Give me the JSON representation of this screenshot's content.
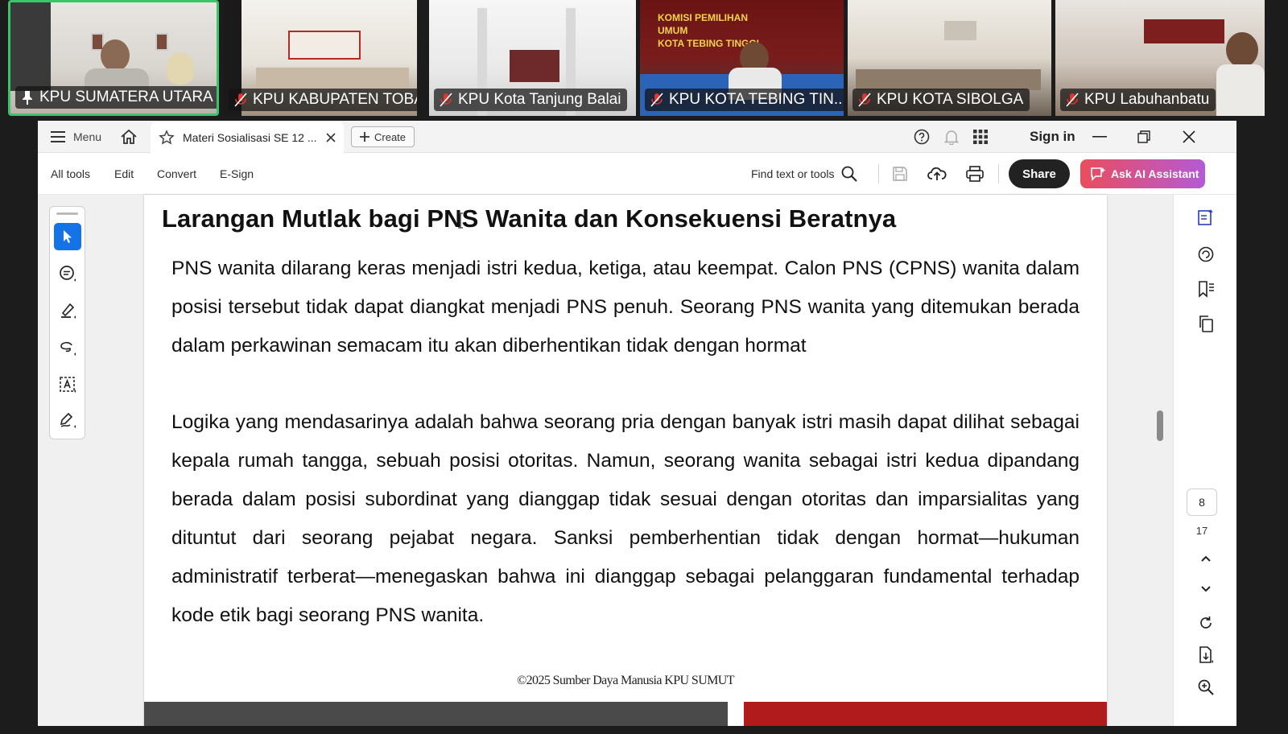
{
  "meeting": {
    "participants": [
      {
        "name": "KPU SUMATERA UTARA",
        "mic": "pinned",
        "active": true
      },
      {
        "name": "KPU KABUPATEN TOBA",
        "mic": "muted",
        "active": false
      },
      {
        "name": "KPU Kota Tanjung Balai",
        "mic": "muted",
        "active": false
      },
      {
        "name": "KPU KOTA TEBING TIN...",
        "mic": "muted",
        "active": false
      },
      {
        "name": "KPU KOTA SIBOLGA",
        "mic": "muted",
        "active": false
      },
      {
        "name": "KPU Labuhanbatu",
        "mic": "muted",
        "active": false
      }
    ],
    "colors": {
      "active_border": "#3cc46a",
      "mute_red": "#e0342c"
    }
  },
  "app": {
    "titlebar": {
      "menu_label": "Menu",
      "tab_title": "Materi Sosialisasi SE 12 ...",
      "create_label": "Create",
      "sign_in_label": "Sign in"
    },
    "toolbar": {
      "all_tools": "All tools",
      "edit": "Edit",
      "convert": "Convert",
      "esign": "E-Sign",
      "find_placeholder": "Find text or tools",
      "share_label": "Share",
      "ai_label": "Ask AI Assistant"
    },
    "document": {
      "heading": "Larangan Mutlak bagi PNS Wanita dan Konsekuensi Beratnya",
      "paragraph_1": "PNS wanita dilarang keras menjadi istri kedua, ketiga, atau keempat. Calon PNS (CPNS) wanita dalam posisi tersebut tidak dapat diangkat menjadi PNS penuh. Seorang PNS wanita yang ditemukan berada dalam perkawinan semacam itu akan diberhentikan tidak dengan hormat",
      "paragraph_2": "Logika yang mendasarinya adalah bahwa seorang pria dengan banyak istri masih dapat dilihat sebagai kepala rumah tangga, sebuah posisi otoritas. Namun, seorang wanita sebagai istri kedua dipandang berada dalam posisi subordinat yang dianggap tidak sesuai dengan otoritas dan imparsialitas yang dituntut dari seorang pejabat negara. Sanksi pemberhentian tidak dengan hormat—hukuman administratif terberat—menegaskan bahwa ini dianggap sebagai pelanggaran fundamental terhadap kode etik bagi seorang PNS wanita.",
      "footer": "©2025 Sumber Daya Manusia  KPU SUMUT"
    },
    "pagination": {
      "current_page": "8",
      "total_pages": "17"
    },
    "colors": {
      "accent": "#1473e6",
      "share_bg": "#222222",
      "ai_from": "#ea4d5d",
      "ai_to": "#b45ad6",
      "band_grey": "#4a4a4a",
      "band_red": "#b21b1b"
    }
  }
}
